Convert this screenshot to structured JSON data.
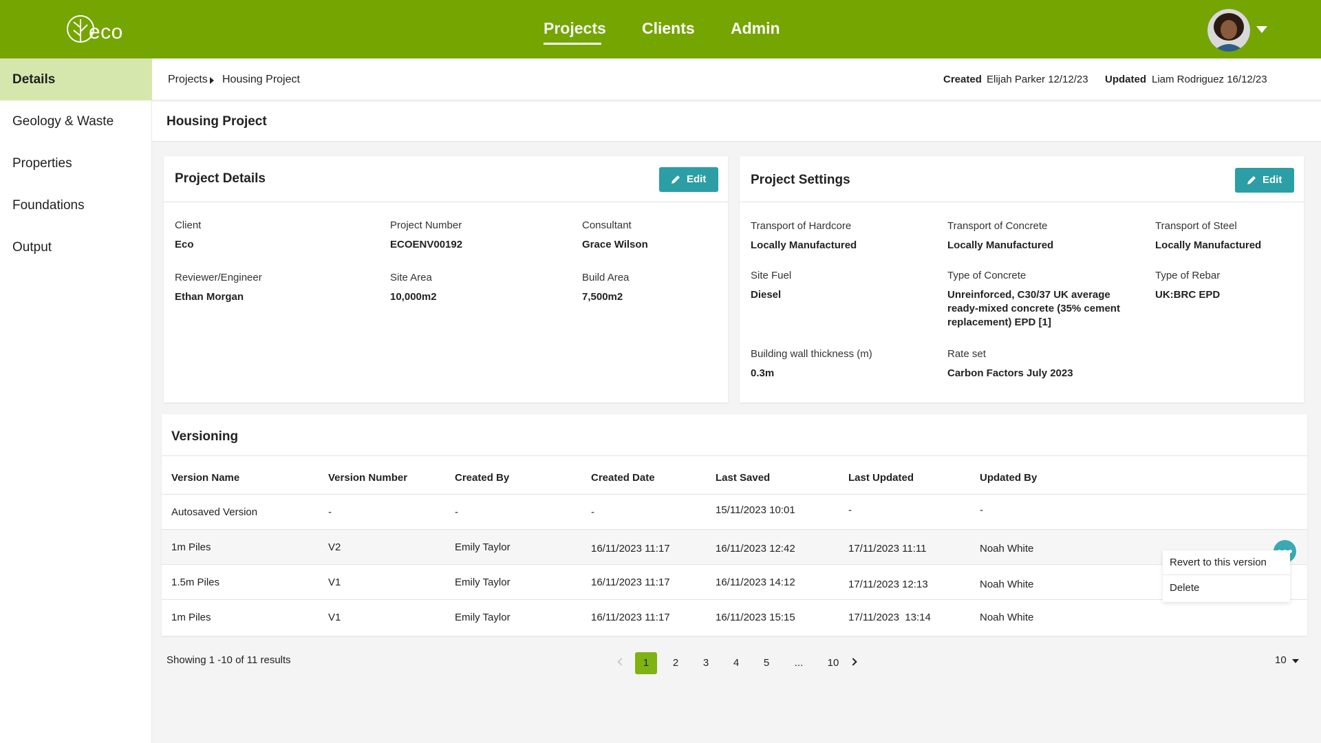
{
  "header": {
    "logo_text": "eco",
    "nav": [
      "Projects",
      "Clients",
      "Admin"
    ],
    "active_nav": "Projects"
  },
  "sidebar": {
    "items": [
      {
        "label": "Details",
        "active": true
      },
      {
        "label": "Geology & Waste",
        "active": false
      },
      {
        "label": "Properties",
        "active": false
      },
      {
        "label": "Foundations",
        "active": false
      },
      {
        "label": "Output",
        "active": false
      }
    ]
  },
  "breadcrumb": {
    "root": "Projects",
    "current": "Housing Project"
  },
  "meta": {
    "created_label": "Created",
    "created_value": "Elijah Parker 12/12/23",
    "updated_label": "Updated",
    "updated_value": "Liam Rodriguez 16/12/23"
  },
  "page_title": "Housing Project",
  "project_details": {
    "title": "Project Details",
    "edit_label": "Edit",
    "fields": {
      "client": {
        "label": "Client",
        "value": "Eco"
      },
      "project_number": {
        "label": "Project Number",
        "value": "ECOENV00192"
      },
      "consultant": {
        "label": "Consultant",
        "value": "Grace Wilson"
      },
      "reviewer": {
        "label": "Reviewer/Engineer",
        "value": "Ethan Morgan"
      },
      "site_area": {
        "label": "Site Area",
        "value": "10,000m2"
      },
      "build_area": {
        "label": "Build Area",
        "value": "7,500m2"
      }
    }
  },
  "project_settings": {
    "title": "Project Settings",
    "edit_label": "Edit",
    "fields": {
      "hardcore": {
        "label": "Transport of Hardcore",
        "value": "Locally Manufactured"
      },
      "concrete": {
        "label": "Transport of Concrete",
        "value": "Locally Manufactured"
      },
      "steel": {
        "label": "Transport of Steel",
        "value": "Locally Manufactured"
      },
      "fuel": {
        "label": "Site Fuel",
        "value": "Diesel"
      },
      "concrete_type": {
        "label": "Type of Concrete",
        "value_lines": [
          "Unreinforced, C30/37 UK average",
          "ready-mixed concrete (35% cement",
          "replacement) EPD [1]"
        ]
      },
      "rebar": {
        "label": "Type of Rebar",
        "value": "UK:BRC EPD"
      },
      "wall": {
        "label": "Building wall thickness (m)",
        "value": "0.3m"
      },
      "rateset": {
        "label": "Rate set",
        "value": "Carbon Factors July 2023"
      }
    }
  },
  "versioning": {
    "title": "Versioning",
    "columns": [
      "Version Name",
      "Version Number",
      "Created By",
      "Created Date",
      "Last Saved",
      "Last Updated",
      "Updated By"
    ],
    "rows": [
      [
        "Autosaved Version",
        "-",
        "-",
        "-",
        "15/11/2023 10:01",
        "-",
        "-"
      ],
      [
        "1m Piles",
        "V2",
        "Emily Taylor",
        "16/11/2023 11:17",
        "16/11/2023 12:42",
        "17/11/2023 11:11",
        "Noah White"
      ],
      [
        "1.5m Piles",
        "V1",
        "Emily Taylor",
        "16/11/2023 11:17",
        "16/11/2023 14:12",
        "17/11/2023 12:13",
        "Noah White"
      ],
      [
        "1m Piles",
        "V1",
        "Emily Taylor",
        "16/11/2023 11:17",
        "16/11/2023 15:15",
        "17/11/2023  13:14",
        "Noah White"
      ]
    ],
    "menu": [
      "Revert to this version",
      "Delete"
    ]
  },
  "pagination": {
    "showing": "Showing 1 -10 of 11 results",
    "pages": [
      "1",
      "2",
      "3",
      "4",
      "5",
      "...",
      "10"
    ],
    "current": "1",
    "per_page": "10"
  },
  "colors": {
    "brand_green": "#75a500",
    "sidebar_active": "#d6e7ad",
    "accent_teal": "#2b9ea6"
  }
}
